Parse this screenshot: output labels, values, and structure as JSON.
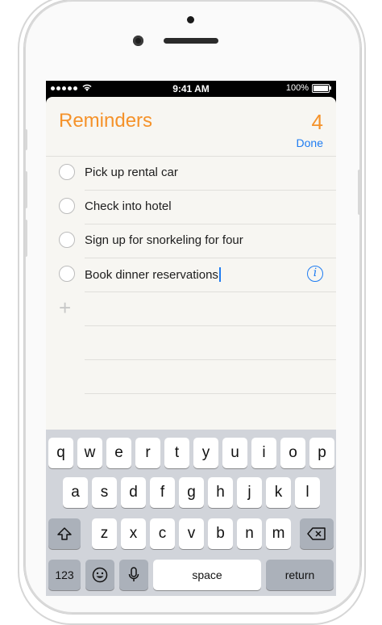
{
  "status_bar": {
    "time": "9:41 AM",
    "battery": "100%"
  },
  "header": {
    "title": "Reminders",
    "count": "4",
    "done_label": "Done"
  },
  "reminders": [
    {
      "text": "Pick up rental car"
    },
    {
      "text": "Check into hotel"
    },
    {
      "text": "Sign up for snorkeling for four"
    },
    {
      "text": "Book dinner reservations"
    }
  ],
  "info_glyph": "i",
  "add_glyph": "+",
  "keyboard": {
    "row1": [
      "q",
      "w",
      "e",
      "r",
      "t",
      "y",
      "u",
      "i",
      "o",
      "p"
    ],
    "row2": [
      "a",
      "s",
      "d",
      "f",
      "g",
      "h",
      "j",
      "k",
      "l"
    ],
    "row3": [
      "z",
      "x",
      "c",
      "v",
      "b",
      "n",
      "m"
    ],
    "numbers_label": "123",
    "space_label": "space",
    "return_label": "return",
    "icons": {
      "shift": "shift-icon",
      "delete": "delete-icon",
      "emoji": "emoji-icon",
      "mic": "mic-icon"
    }
  },
  "colors": {
    "accent_orange": "#f5922a",
    "accent_blue": "#1e7cf2",
    "keyboard_bg": "#d1d4da"
  }
}
